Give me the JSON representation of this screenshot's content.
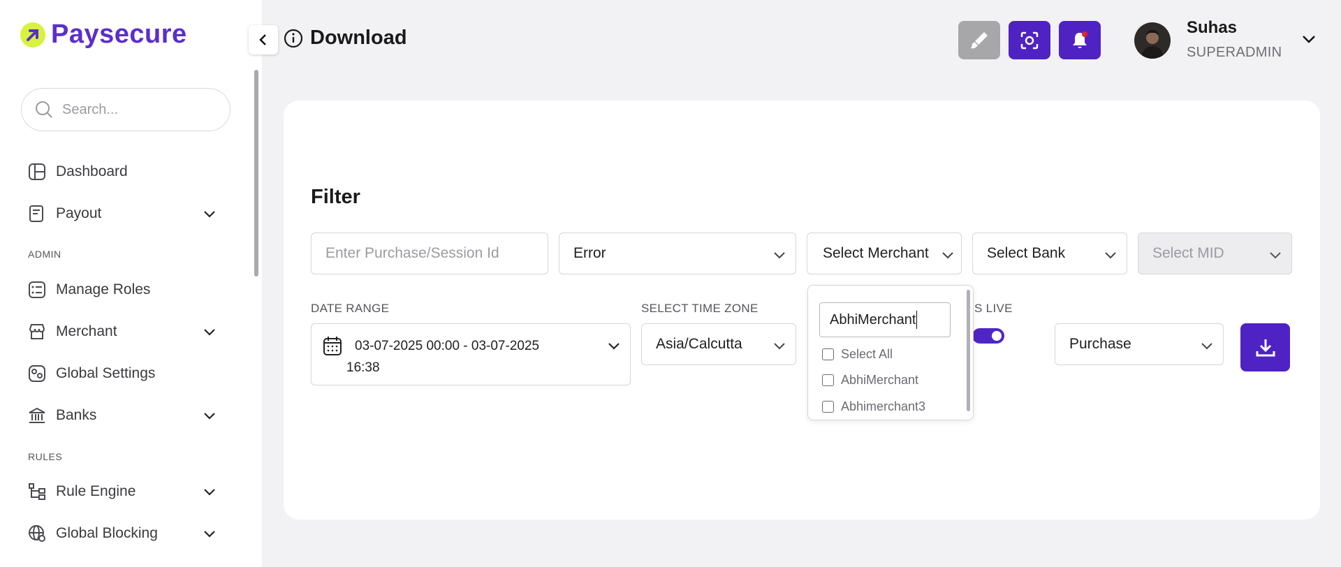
{
  "brand": {
    "name": "Paysecure",
    "accent": "#5b2fc9",
    "logo_color": "#d7f23f"
  },
  "sidebar": {
    "search_placeholder": "Search...",
    "items": [
      {
        "label": "Dashboard",
        "icon": "dashboard-icon"
      },
      {
        "label": "Payout",
        "icon": "payout-icon",
        "expandable": true
      },
      {
        "label": "Manage Roles",
        "icon": "roles-icon"
      },
      {
        "label": "Merchant",
        "icon": "merchant-icon",
        "expandable": true
      },
      {
        "label": "Global Settings",
        "icon": "settings-icon"
      },
      {
        "label": "Banks",
        "icon": "bank-icon",
        "expandable": true
      },
      {
        "label": "Rule Engine",
        "icon": "rule-engine-icon",
        "expandable": true
      },
      {
        "label": "Global Blocking",
        "icon": "global-blocking-icon",
        "expandable": true
      }
    ],
    "sections": {
      "admin": "ADMIN",
      "rules": "RULES"
    }
  },
  "header": {
    "title": "Download",
    "user": {
      "name": "Suhas",
      "role": "SUPERADMIN"
    }
  },
  "filter": {
    "title": "Filter",
    "purchase_id_placeholder": "Enter Purchase/Session Id",
    "status_value": "Error",
    "merchant_label": "Select Merchant",
    "bank_label": "Select Bank",
    "mid_label": "Select MID",
    "date_range_label": "DATE RANGE",
    "date_range_value_line1": "03-07-2025 00:00 - 03-07-2025",
    "date_range_value_line2": "16:38",
    "time_zone_label": "SELECT TIME ZONE",
    "time_zone_value": "Asia/Calcutta",
    "is_live_label": "IS LIVE",
    "is_live_on": true,
    "type_value": "Purchase"
  },
  "merchant_dropdown": {
    "search_value": "AbhiMerchant",
    "options": [
      "Select All",
      "AbhiMerchant",
      "Abhimerchant3"
    ]
  }
}
